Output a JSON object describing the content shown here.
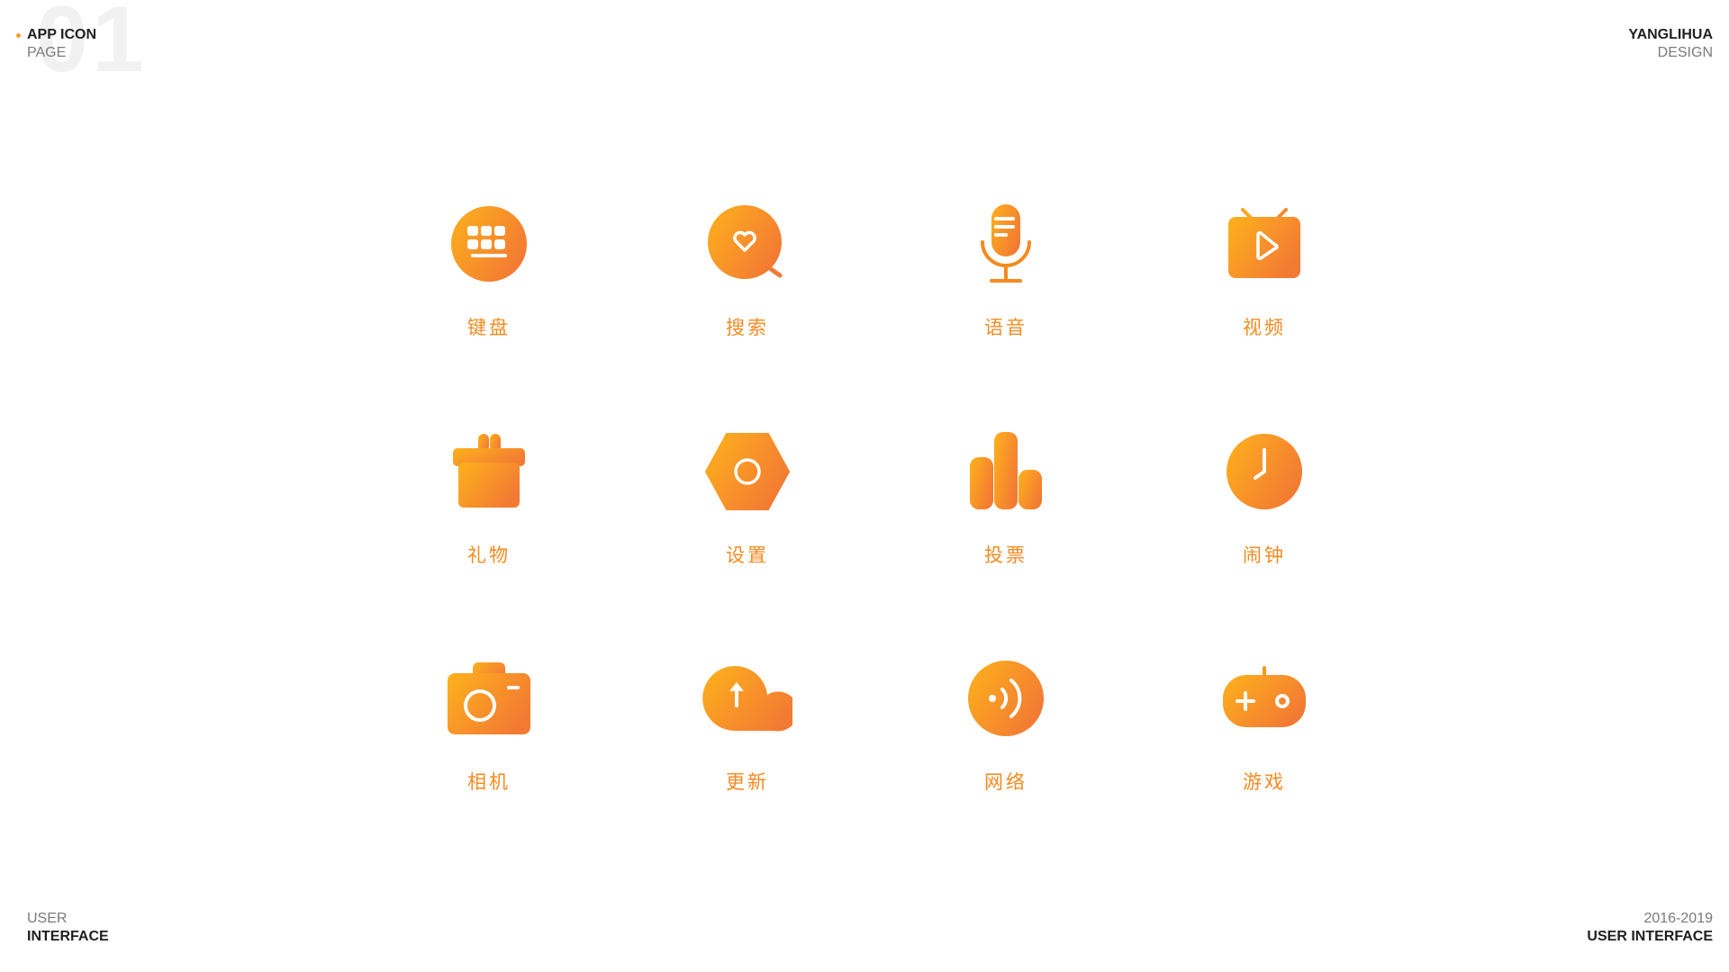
{
  "header": {
    "page_number": "01",
    "title_top": "APP ICON",
    "title_bottom": "PAGE",
    "brand_top": "YANGLIHUA",
    "brand_bottom": "DESIGN"
  },
  "footer": {
    "left_top": "USER",
    "left_bottom": "INTERFACE",
    "right_top": "2016-2019",
    "right_bottom": "USER INTERFACE"
  },
  "colors": {
    "gradient_start": "#FDB21C",
    "gradient_end": "#F37A33",
    "label": "#F58A1F",
    "accent_dot": "#F7A02C"
  },
  "icons": [
    {
      "label": "键盘",
      "icon": "keyboard-icon"
    },
    {
      "label": "搜索",
      "icon": "search-icon"
    },
    {
      "label": "语音",
      "icon": "microphone-icon"
    },
    {
      "label": "视频",
      "icon": "video-icon"
    },
    {
      "label": "礼物",
      "icon": "gift-icon"
    },
    {
      "label": "设置",
      "icon": "settings-icon"
    },
    {
      "label": "投票",
      "icon": "vote-icon"
    },
    {
      "label": "闹钟",
      "icon": "alarm-clock-icon"
    },
    {
      "label": "相机",
      "icon": "camera-icon"
    },
    {
      "label": "更新",
      "icon": "update-cloud-icon"
    },
    {
      "label": "网络",
      "icon": "network-icon"
    },
    {
      "label": "游戏",
      "icon": "gamepad-icon"
    }
  ]
}
